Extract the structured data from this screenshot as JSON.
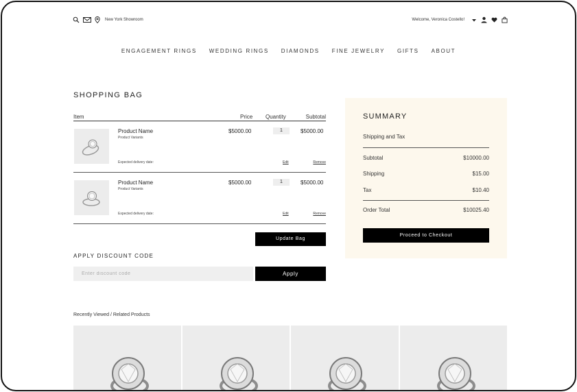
{
  "topbar": {
    "showroom": "New York Showroom",
    "welcome": "Welcome, Veronica Costello!"
  },
  "nav": [
    "ENGAGEMENT RINGS",
    "WEDDING RINGS",
    "DIAMONDS",
    "FINE JEWELRY",
    "GIFTS",
    "ABOUT"
  ],
  "bag": {
    "title": "SHOPPING BAG",
    "headers": {
      "item": "Item",
      "price": "Price",
      "quantity": "Quantity",
      "subtotal": "Subtotal"
    },
    "items": [
      {
        "name": "Product Name",
        "variants": "Product Variants",
        "price": "$5000.00",
        "qty": "1",
        "subtotal": "$5000.00",
        "delivery": "Expected delivery date:",
        "edit": "Edit",
        "remove": "Remove"
      },
      {
        "name": "Product Name",
        "variants": "Product Variants",
        "price": "$5000.00",
        "qty": "1",
        "subtotal": "$5000.00",
        "delivery": "Expected delivery date:",
        "edit": "Edit",
        "remove": "Remove"
      }
    ],
    "update_label": "Update Bag"
  },
  "discount": {
    "title": "APPLY DISCOUNT CODE",
    "placeholder": "Enter discount code",
    "apply_label": "Apply"
  },
  "summary": {
    "title": "SUMMARY",
    "shipping_tax": "Shipping and Tax",
    "subtotal_label": "Subtotal",
    "subtotal": "$10000.00",
    "shipping_label": "Shipping",
    "shipping": "$15.00",
    "tax_label": "Tax",
    "tax": "$10.40",
    "total_label": "Order Total",
    "total": "$10025.40",
    "checkout_label": "Proceed to Checkout"
  },
  "recent": {
    "title": "Recently Viewed / Related Products"
  },
  "icons": [
    "search-icon",
    "mail-icon",
    "location-pin-icon",
    "chevron-down-icon",
    "user-icon",
    "heart-icon",
    "bag-icon"
  ]
}
